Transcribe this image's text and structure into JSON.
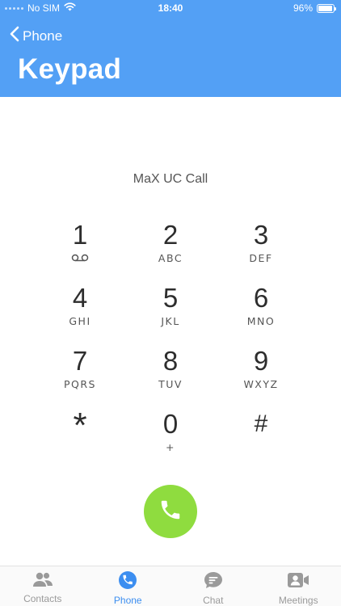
{
  "status_bar": {
    "carrier": "No SIM",
    "time": "18:40",
    "battery_percent": "96%",
    "battery_level": 0.96
  },
  "header": {
    "back_label": "Phone",
    "title": "Keypad",
    "color": "#53a0f5"
  },
  "call_label": "MaX UC Call",
  "keypad": {
    "keys": [
      {
        "digit": "1",
        "letters": ""
      },
      {
        "digit": "2",
        "letters": "ABC"
      },
      {
        "digit": "3",
        "letters": "DEF"
      },
      {
        "digit": "4",
        "letters": "GHI"
      },
      {
        "digit": "5",
        "letters": "JKL"
      },
      {
        "digit": "6",
        "letters": "MNO"
      },
      {
        "digit": "7",
        "letters": "PQRS"
      },
      {
        "digit": "8",
        "letters": "TUV"
      },
      {
        "digit": "9",
        "letters": "WXYZ"
      },
      {
        "digit": "*",
        "letters": ""
      },
      {
        "digit": "0",
        "letters": "+"
      },
      {
        "digit": "#",
        "letters": ""
      }
    ]
  },
  "call_button": {
    "icon": "phone-icon",
    "color": "#8fdc3f"
  },
  "tabs": [
    {
      "label": "Contacts",
      "icon": "contacts-icon"
    },
    {
      "label": "Phone",
      "icon": "phone-icon",
      "active": true
    },
    {
      "label": "Chat",
      "icon": "chat-icon"
    },
    {
      "label": "Meetings",
      "icon": "meetings-icon"
    }
  ],
  "colors": {
    "active_tab": "#3c8ef0",
    "inactive_tab": "#9a9a9a"
  }
}
